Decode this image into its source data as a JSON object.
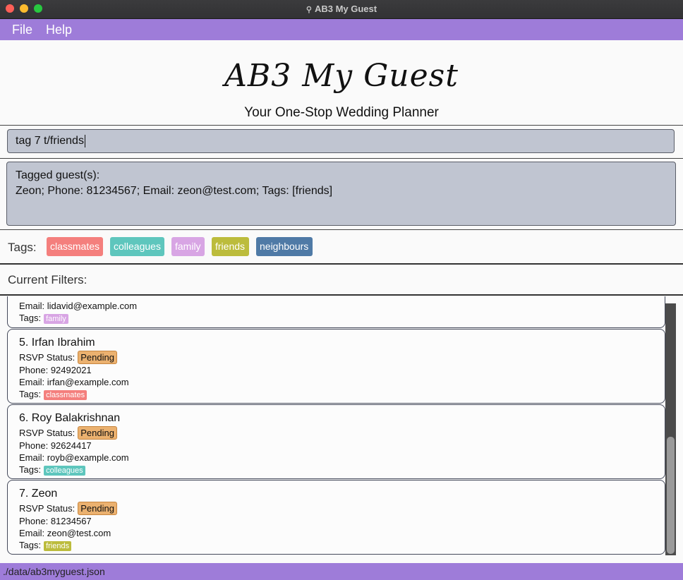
{
  "window": {
    "title": "AB3 My Guest"
  },
  "menu": {
    "file": "File",
    "help": "Help"
  },
  "header": {
    "title": "AB3 My Guest",
    "subtitle": "Your One-Stop Wedding Planner"
  },
  "command": {
    "value": "tag 7 t/friends"
  },
  "result": {
    "line1": "Tagged guest(s):",
    "line2": "Zeon; Phone: 81234567; Email: zeon@test.com; Tags: [friends]"
  },
  "tags": {
    "label": "Tags:",
    "items": [
      {
        "label": "classmates",
        "color": "#f47f7d"
      },
      {
        "label": "colleagues",
        "color": "#5ec6bd"
      },
      {
        "label": "family",
        "color": "#d8a5e4"
      },
      {
        "label": "friends",
        "color": "#bcbc3c"
      },
      {
        "label": "neighbours",
        "color": "#4f7aa6"
      }
    ]
  },
  "filters": {
    "label": "Current Filters:"
  },
  "guests": {
    "partial": {
      "email": "Email: lidavid@example.com",
      "tags_label": "Tags:",
      "tag": "family"
    },
    "cards": [
      {
        "name": "5. Irfan Ibrahim",
        "rsvp_label": "RSVP Status:",
        "rsvp": "Pending",
        "phone": "Phone: 92492021",
        "email": "Email: irfan@example.com",
        "tags_label": "Tags:",
        "tag": "classmates",
        "tag_color": "#f47f7d"
      },
      {
        "name": "6. Roy Balakrishnan",
        "rsvp_label": "RSVP Status:",
        "rsvp": "Pending",
        "phone": "Phone: 92624417",
        "email": "Email: royb@example.com",
        "tags_label": "Tags:",
        "tag": "colleagues",
        "tag_color": "#5ec6bd"
      },
      {
        "name": "7. Zeon",
        "rsvp_label": "RSVP Status:",
        "rsvp": "Pending",
        "phone": "Phone: 81234567",
        "email": "Email: zeon@test.com",
        "tags_label": "Tags:",
        "tag": "friends",
        "tag_color": "#bcbc3c"
      }
    ]
  },
  "status": {
    "path": "./data/ab3myguest.json"
  }
}
